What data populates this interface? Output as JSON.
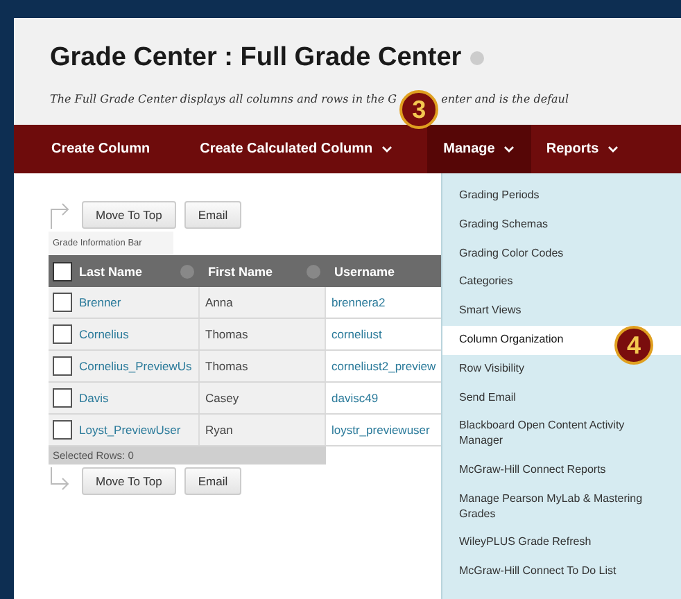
{
  "page": {
    "title": "Grade Center : Full Grade Center",
    "description_before": "The Full Grade Center displays all columns and rows in the G",
    "description_after": "enter and is the defaul"
  },
  "nav": [
    {
      "label": "Create Column",
      "has_menu": false,
      "selected": false
    },
    {
      "label": "Create Calculated Column",
      "has_menu": true,
      "selected": false
    },
    {
      "label": "Manage",
      "has_menu": true,
      "selected": true
    },
    {
      "label": "Reports",
      "has_menu": true,
      "selected": false
    }
  ],
  "top_actions": [
    "Move To Top",
    "Email"
  ],
  "info_bar": "Grade Information Bar",
  "table": {
    "header_checked": false,
    "columns": [
      "Last Name",
      "First Name",
      "Username"
    ],
    "rows": [
      {
        "cells": [
          "Brenner",
          "Anna",
          "brennera2"
        ],
        "checked": false
      },
      {
        "cells": [
          "Cornelius",
          "Thomas",
          "corneliust"
        ],
        "checked": false
      },
      {
        "cells": [
          "Cornelius_PreviewUs",
          "Thomas",
          "corneliust2_preview"
        ],
        "checked": false
      },
      {
        "cells": [
          "Davis",
          "Casey",
          "davisc49"
        ],
        "checked": false
      },
      {
        "cells": [
          "Loyst_PreviewUser",
          "Ryan",
          "loystr_previewuser"
        ],
        "checked": false
      }
    ]
  },
  "selected_rows": "Selected Rows: 0",
  "bottom_actions": [
    "Move To Top",
    "Email"
  ],
  "manage_menu": [
    {
      "label": "Grading Periods",
      "selected": false
    },
    {
      "label": "Grading Schemas",
      "selected": false
    },
    {
      "label": "Grading Color Codes",
      "selected": false
    },
    {
      "label": "Categories",
      "selected": false
    },
    {
      "label": "Smart Views",
      "selected": false
    },
    {
      "label": "Column Organization",
      "selected": true
    },
    {
      "label": "Row Visibility",
      "selected": false
    },
    {
      "label": "Send Email",
      "selected": false
    },
    {
      "label": "Blackboard Open Content Activity Manager",
      "selected": false
    },
    {
      "label": "McGraw-Hill Connect Reports",
      "selected": false
    },
    {
      "label": "Manage Pearson MyLab & Mastering Grades",
      "selected": false
    },
    {
      "label": "WileyPLUS Grade Refresh",
      "selected": false
    },
    {
      "label": "McGraw-Hill Connect To Do List",
      "selected": false
    }
  ],
  "callouts": [
    {
      "number": "3"
    },
    {
      "number": "4"
    }
  ]
}
